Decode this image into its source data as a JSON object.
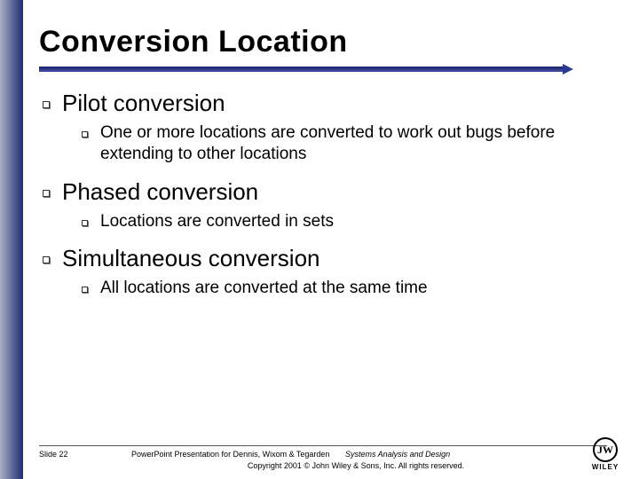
{
  "title": "Conversion Location",
  "items": [
    {
      "label": "Pilot conversion",
      "sub": "One or more locations are converted to work out bugs before extending to other locations"
    },
    {
      "label": "Phased conversion",
      "sub": "Locations are converted in sets"
    },
    {
      "label": "Simultaneous conversion",
      "sub": "All locations are converted at the same time"
    }
  ],
  "footer": {
    "slide": "Slide 22",
    "presentation_line": "PowerPoint Presentation for Dennis, Wixom & Tegarden",
    "book_title": "Systems Analysis and Design",
    "copyright": "Copyright 2001 © John Wiley & Sons, Inc.  All rights reserved."
  },
  "logo": {
    "mark": "JW",
    "name": "WILEY"
  }
}
